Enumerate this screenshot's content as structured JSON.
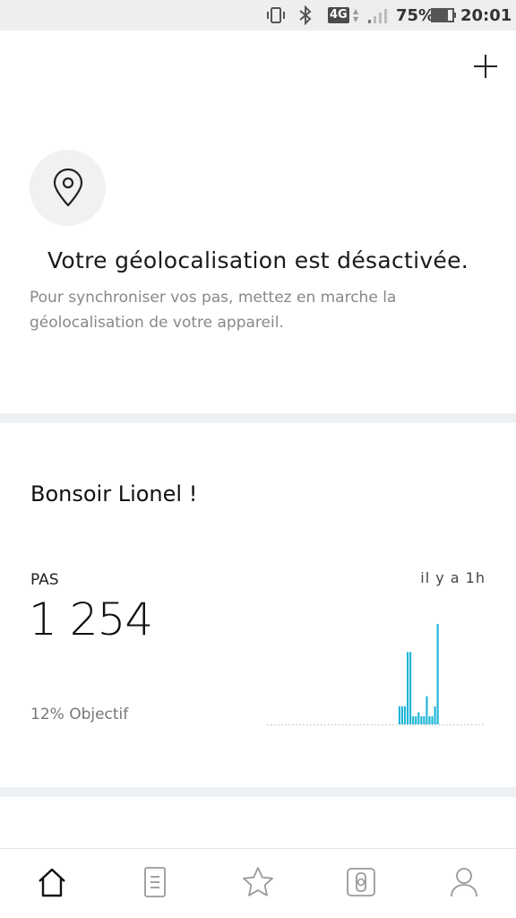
{
  "status_bar": {
    "network": "4G",
    "battery_percent": "75%",
    "time": "20:01",
    "icons": [
      "vibrate-icon",
      "bluetooth-icon",
      "signal-icon",
      "battery-icon"
    ]
  },
  "header": {
    "add_icon": "plus-icon"
  },
  "geolocation": {
    "icon": "location-pin-icon",
    "title": "Votre géolocalisation est désactivée.",
    "message": "Pour synchroniser vos pas, mettez en marche la géolocalisation de votre appareil."
  },
  "greeting": "Bonsoir Lionel !",
  "steps": {
    "label": "PAS",
    "last_update": "il y a 1h",
    "value": "1 254",
    "goal_text": "12% Objectif",
    "goal_percent": 12
  },
  "chart_data": {
    "type": "bar",
    "color": "#1fb5d6",
    "values": [
      0,
      0,
      0,
      0,
      0,
      0,
      0,
      0,
      0,
      0,
      0,
      0,
      0,
      0,
      0,
      0,
      0,
      0,
      0,
      0,
      0,
      0,
      0,
      0,
      0,
      0,
      0,
      0,
      0,
      0,
      0,
      0,
      0,
      0,
      0,
      0,
      0,
      0,
      0,
      0,
      0,
      0,
      0,
      0,
      0,
      0,
      0,
      0,
      18,
      18,
      18,
      72,
      72,
      8,
      8,
      12,
      8,
      8,
      28,
      8,
      8,
      18,
      100,
      0,
      0,
      0,
      0,
      0,
      0,
      0,
      0,
      0,
      0,
      0,
      0,
      0,
      0,
      0,
      0,
      0
    ],
    "ylim": [
      0,
      100
    ]
  },
  "tabs": [
    {
      "name": "home",
      "icon": "home-icon",
      "active": true
    },
    {
      "name": "journal",
      "icon": "document-icon",
      "active": false
    },
    {
      "name": "favorites",
      "icon": "star-icon",
      "active": false
    },
    {
      "name": "device",
      "icon": "watch-icon",
      "active": false
    },
    {
      "name": "profile",
      "icon": "person-icon",
      "active": false
    }
  ],
  "colors": {
    "accent": "#1fb5d6",
    "divider": "#eef1f3",
    "icon_circle": "#eff1f3",
    "status_bar": "#eeeeee"
  }
}
